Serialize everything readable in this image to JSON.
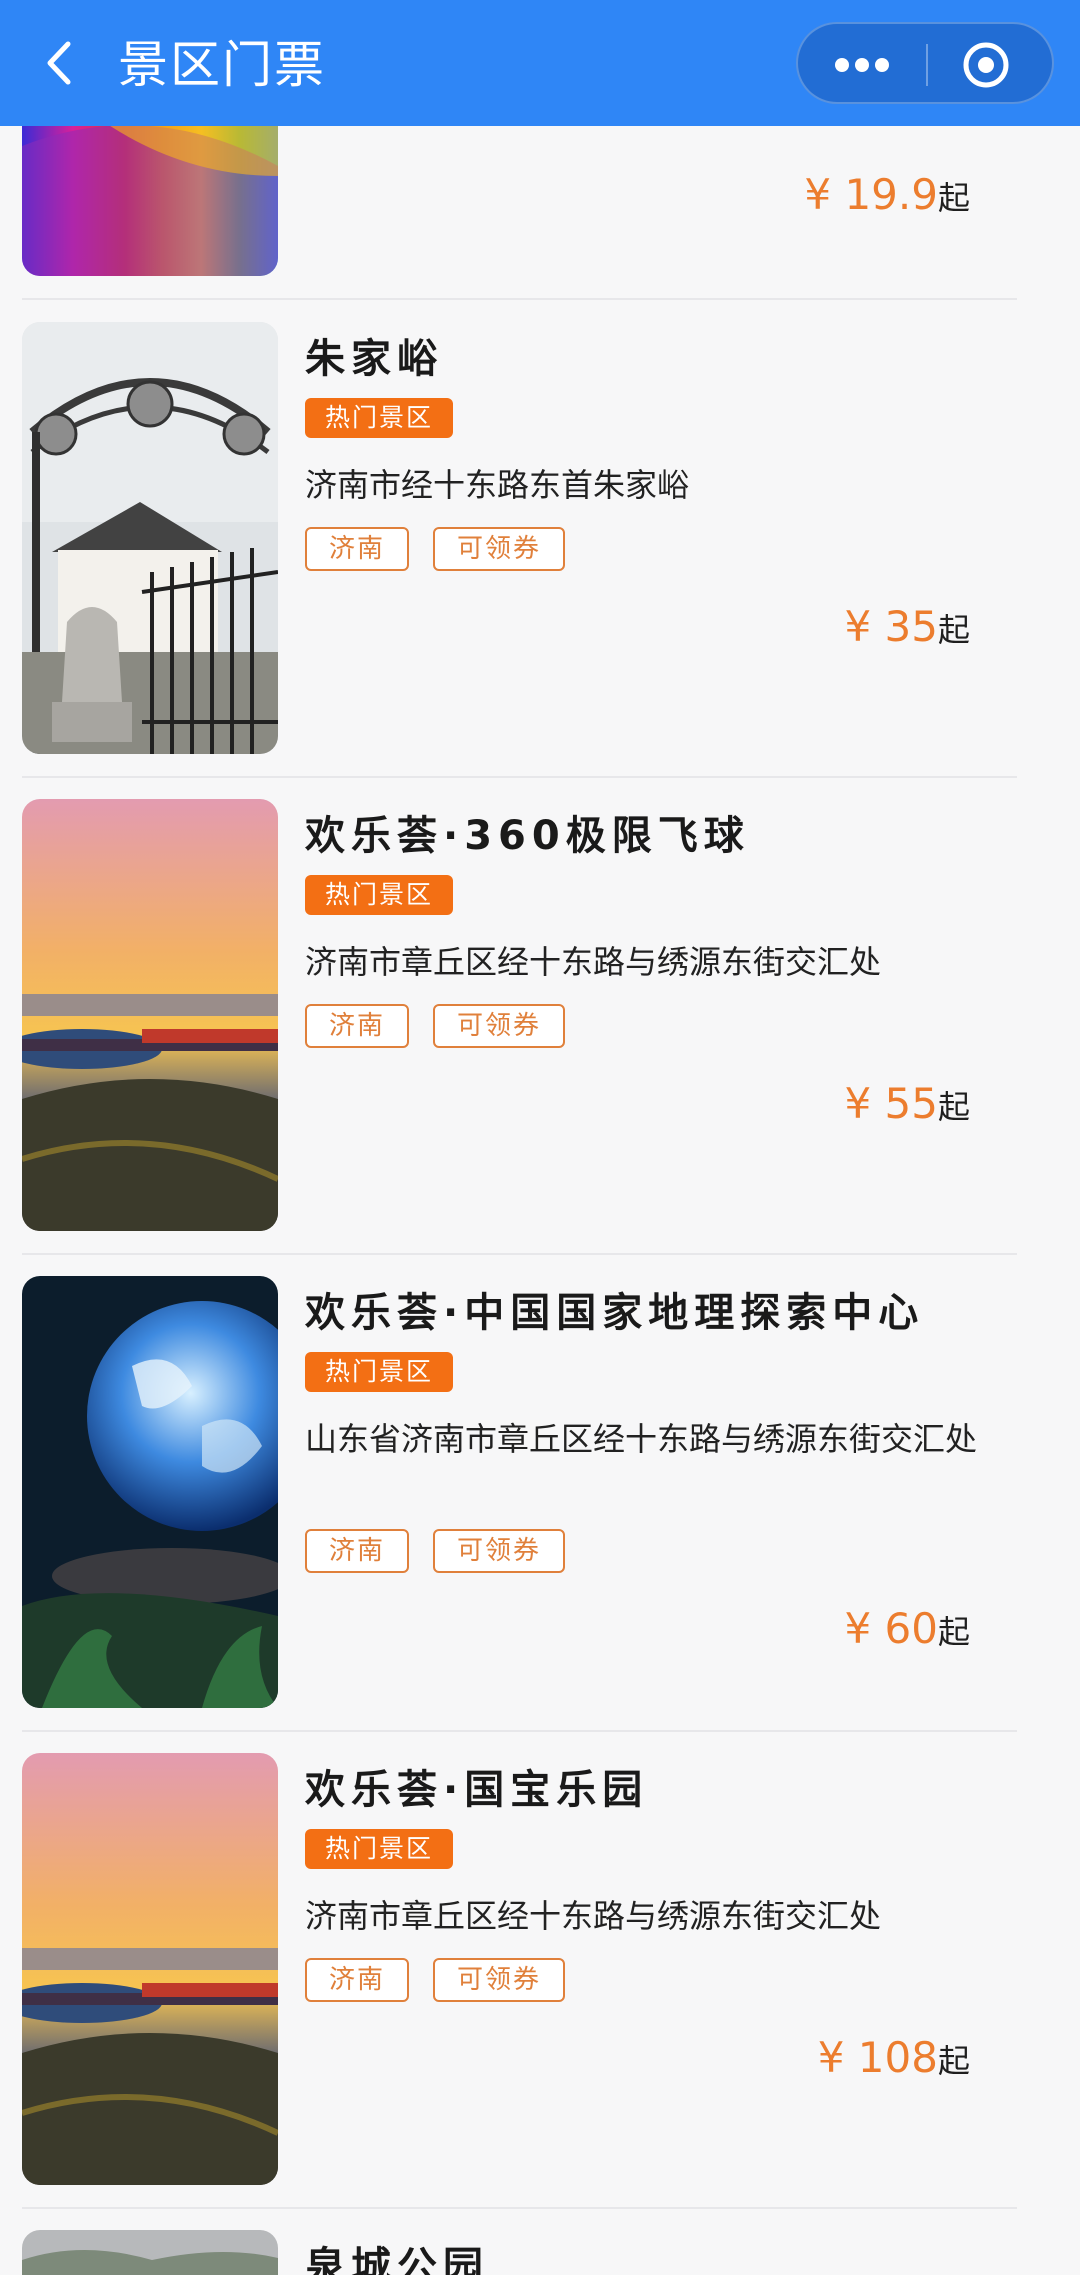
{
  "header": {
    "title": "景区门票",
    "bar_color": "#2f86f6"
  },
  "items": [
    {
      "name": "",
      "hot": "",
      "address": "",
      "tags": [],
      "price": "¥ 19.9",
      "suffix": "起",
      "image": "rainbow-field"
    },
    {
      "name": "朱家峪",
      "hot": "热门景区",
      "address": "济南市经十东路东首朱家峪",
      "tags": [
        "济南",
        "可领券"
      ],
      "price": "¥ 35",
      "suffix": "起",
      "image": "village-gate"
    },
    {
      "name": "欢乐荟·360极限飞球",
      "hot": "热门景区",
      "address": "济南市章丘区经十东路与绣源东街交汇处",
      "tags": [
        "济南",
        "可领券"
      ],
      "price": "¥ 55",
      "suffix": "起",
      "image": "sunset-park"
    },
    {
      "name": "欢乐荟·中国国家地理探索中心",
      "hot": "热门景区",
      "address": "山东省济南市章丘区经十东路与绣源东街交汇处",
      "tags": [
        "济南",
        "可领券"
      ],
      "price": "¥ 60",
      "suffix": "起",
      "image": "globe"
    },
    {
      "name": "欢乐荟·国宝乐园",
      "hot": "热门景区",
      "address": "济南市章丘区经十东路与绣源东街交汇处",
      "tags": [
        "济南",
        "可领券"
      ],
      "price": "¥ 108",
      "suffix": "起",
      "image": "sunset-park"
    },
    {
      "name": "泉城公园",
      "hot": "",
      "address": "",
      "tags": [],
      "price": "",
      "suffix": "",
      "image": "park"
    }
  ],
  "colors": {
    "accent": "#f36f14",
    "price": "#ec7d2e",
    "tag_border": "#e0803b"
  }
}
